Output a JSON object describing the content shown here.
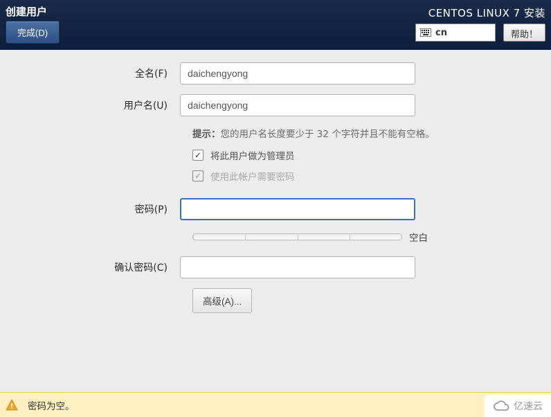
{
  "header": {
    "title": "创建用户",
    "done_label": "完成(D)",
    "install_title": "CENTOS LINUX 7 安装",
    "lang_code": "cn",
    "help_label": "帮助！"
  },
  "form": {
    "fullname_label": "全名(F)",
    "fullname_value": "daichengyong",
    "username_label": "用户名(U)",
    "username_value": "daichengyong",
    "hint_prefix": "提示：",
    "hint_text": "您的用户名长度要少于 32 个字符并且不能有空格。",
    "admin_label": "将此用户做为管理员",
    "require_pw_label": "使用此帐户需要密码",
    "password_label": "密码(P)",
    "strength_text": "空白",
    "confirm_label": "确认密码(C)",
    "advanced_label": "高级(A)..."
  },
  "warning": {
    "text": "密码为空。"
  },
  "watermark": {
    "text": "亿速云"
  }
}
